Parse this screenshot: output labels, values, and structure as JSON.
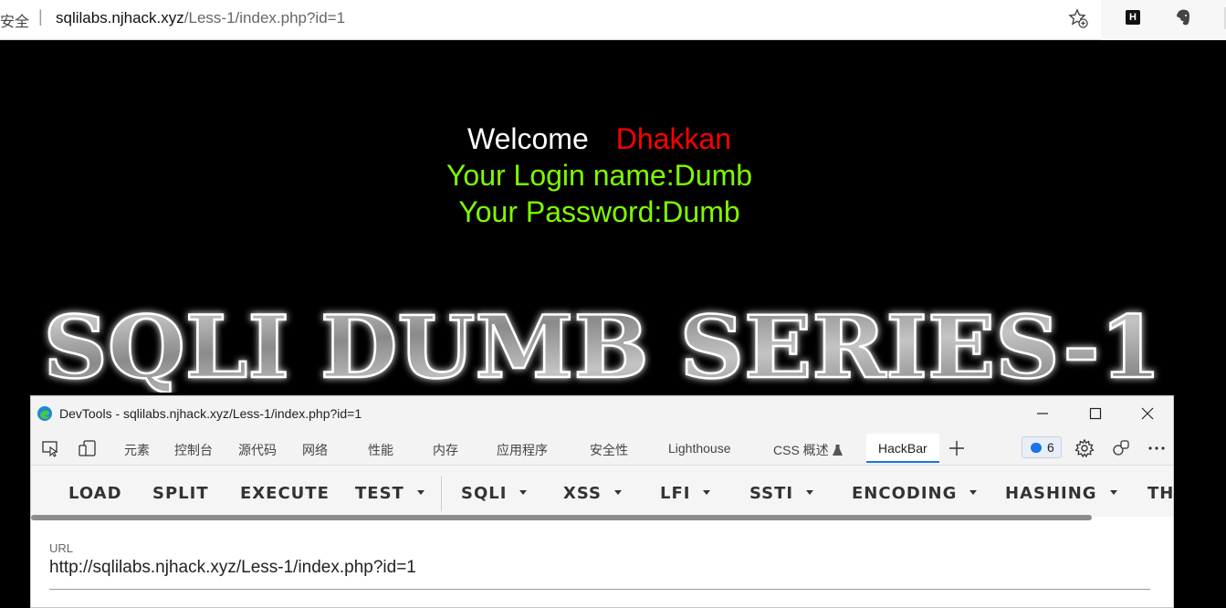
{
  "browser": {
    "security_label": "安全",
    "url_host": "sqlilabs.njhack.xyz",
    "url_path": "/Less-1/index.php?id=1"
  },
  "page": {
    "welcome": "Welcome",
    "user_name": "Dhakkan",
    "login_line": "Your Login name:Dumb",
    "password_line": "Your Password:Dumb",
    "banner_text": "SQLI DUMB SERIES-1"
  },
  "devtools": {
    "title": "DevTools - sqlilabs.njhack.xyz/Less-1/index.php?id=1",
    "tabs": [
      "元素",
      "控制台",
      "源代码",
      "网络",
      "性能",
      "内存",
      "应用程序",
      "安全性",
      "Lighthouse",
      "CSS 概述",
      "HackBar"
    ],
    "active_tab": "HackBar",
    "issues_count": "6"
  },
  "hackbar": {
    "buttons": [
      "LOAD",
      "SPLIT",
      "EXECUTE",
      "TEST",
      "SQLI",
      "XSS",
      "LFI",
      "SSTI",
      "ENCODING",
      "HASHING",
      "TH"
    ],
    "url_label": "URL",
    "url_value": "http://sqlilabs.njhack.xyz/Less-1/index.php?id=1"
  },
  "colors": {
    "welcome": "#ffffff",
    "name": "#ff0000",
    "green_text": "#7dfc00",
    "accent": "#1a73e8"
  }
}
